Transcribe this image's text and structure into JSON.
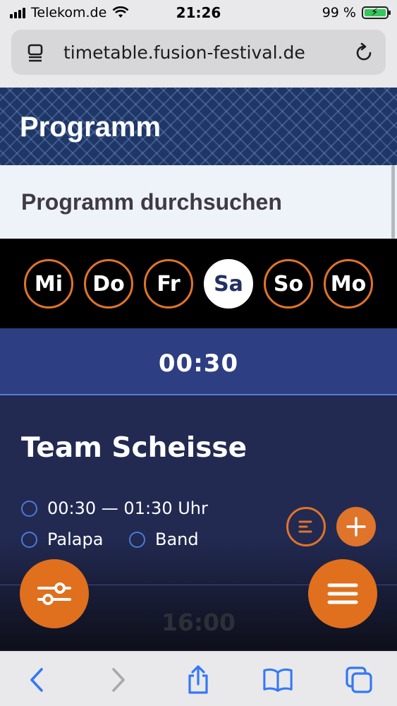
{
  "status_bar": {
    "carrier": "Telekom.de",
    "time": "21:26",
    "battery": "99 %"
  },
  "browser": {
    "url": "timetable.fusion-festival.de"
  },
  "header": {
    "title": "Programm"
  },
  "search": {
    "label": "Programm durchsuchen"
  },
  "days": [
    {
      "label": "Mi",
      "active": false
    },
    {
      "label": "Do",
      "active": false
    },
    {
      "label": "Fr",
      "active": false
    },
    {
      "label": "Sa",
      "active": true
    },
    {
      "label": "So",
      "active": false
    },
    {
      "label": "Mo",
      "active": false
    }
  ],
  "timeslot": {
    "time": "00:30"
  },
  "event": {
    "title": "Team Scheisse",
    "time_range": "00:30 — 01:30 Uhr",
    "venue": "Palapa",
    "category": "Band"
  },
  "next_timeslot": {
    "time": "16:00"
  },
  "colors": {
    "accent": "#e0742a",
    "header_bg": "#1f3766",
    "slot_bg": "#2e3e82",
    "card_bg": "#222a52",
    "icon_blue": "#3478f6"
  },
  "icons": [
    "wifi-icon",
    "reader-icon",
    "reload-icon",
    "list-icon",
    "plus-icon",
    "filter-icon",
    "menu-icon",
    "back-icon",
    "forward-icon",
    "share-icon",
    "bookmarks-icon",
    "tabs-icon"
  ]
}
